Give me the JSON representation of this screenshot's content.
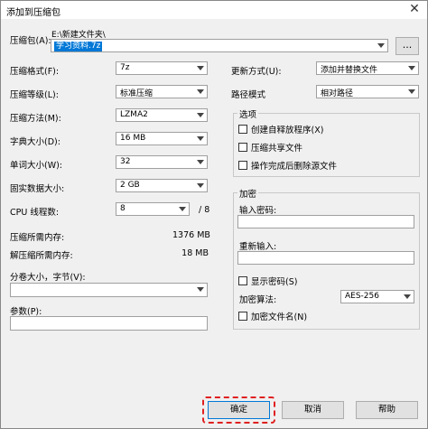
{
  "window": {
    "title": "添加到压缩包",
    "close_glyph": "✕"
  },
  "archive": {
    "label": "压缩包(A):",
    "path": "E:\\新建文件夹\\",
    "filename": "学习资料.7z",
    "browse_label": "..."
  },
  "left": {
    "format": {
      "label": "压缩格式(F):",
      "value": "7z"
    },
    "level": {
      "label": "压缩等级(L):",
      "value": "标准压缩"
    },
    "method": {
      "label": "压缩方法(M):",
      "value": "LZMA2"
    },
    "dict": {
      "label": "字典大小(D):",
      "value": "16 MB"
    },
    "word": {
      "label": "单词大小(W):",
      "value": "32"
    },
    "solid": {
      "label": "固实数据大小:",
      "value": "2 GB"
    },
    "threads": {
      "label": "CPU 线程数:",
      "value": "8",
      "total": "/ 8"
    },
    "mem_compress": {
      "label": "压缩所需内存:",
      "value": "1376 MB"
    },
    "mem_decompress": {
      "label": "解压缩所需内存:",
      "value": "18 MB"
    },
    "volume": {
      "label": "分卷大小，字节(V):",
      "value": ""
    },
    "params": {
      "label": "参数(P):",
      "value": ""
    }
  },
  "right": {
    "update": {
      "label": "更新方式(U):",
      "value": "添加并替换文件"
    },
    "pathmode": {
      "label": "路径模式",
      "value": "相对路径"
    },
    "options": {
      "legend": "选项",
      "sfx": "创建自释放程序(X)",
      "shared": "压缩共享文件",
      "delete": "操作完成后删除源文件"
    },
    "encryption": {
      "legend": "加密",
      "password_label": "输入密码:",
      "reenter_label": "重新输入:",
      "show_password": "显示密码(S)",
      "method_label": "加密算法:",
      "method_value": "AES-256",
      "encrypt_names": "加密文件名(N)"
    }
  },
  "buttons": {
    "ok": "确定",
    "cancel": "取消",
    "help": "帮助"
  }
}
